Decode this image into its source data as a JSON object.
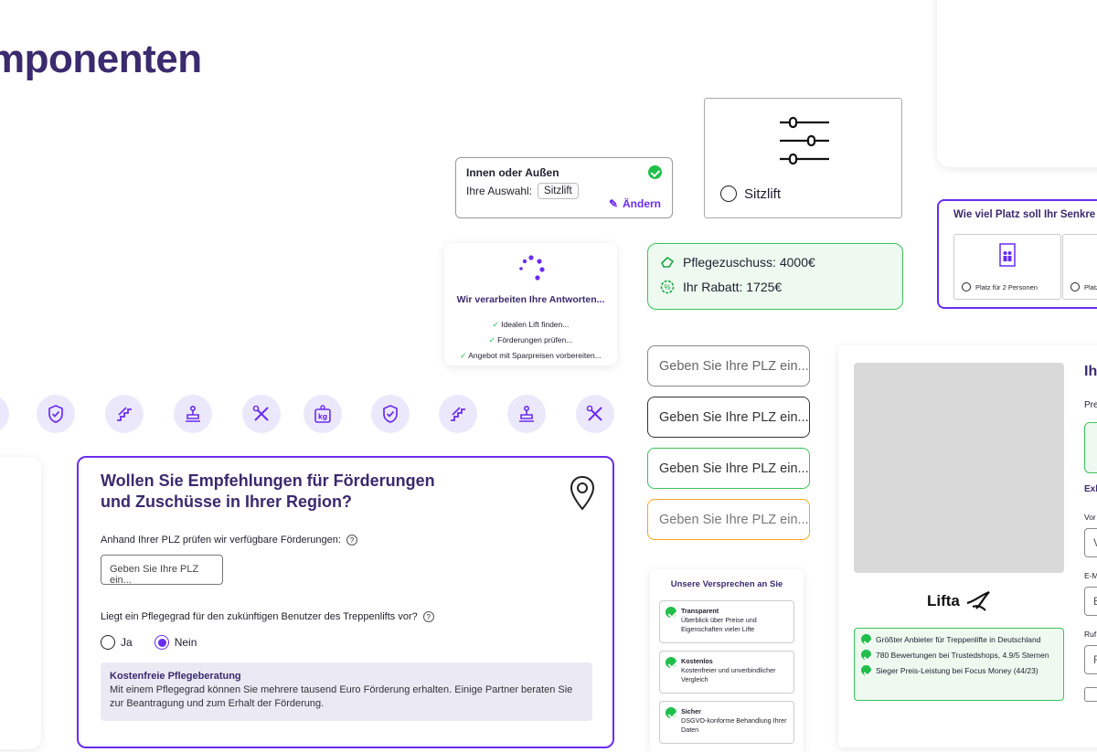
{
  "page_title": "mponenten",
  "selection": {
    "title": "Innen oder Außen",
    "label": "Ihre Auswahl:",
    "value": "Sitzlift",
    "change": "Ändern"
  },
  "option_card": {
    "label": "Sitzlift"
  },
  "processing": {
    "title": "Wir verarbeiten Ihre Antworten...",
    "steps": [
      "Idealen Lift finden...",
      "Förderungen prüfen...",
      "Angebot mit Sparpreisen vorbereiten..."
    ]
  },
  "subsidy": {
    "care": "Pflegezuschuss: 4000€",
    "discount": "Ihr Rabatt: 1725€"
  },
  "space": {
    "title": "Wie viel Platz soll Ihr Senkre",
    "opt1": "Platz für 2 Personen",
    "opt2": "Platz"
  },
  "plz_inputs": [
    "Geben Sie Ihre PLZ ein...",
    "Geben Sie Ihre PLZ ein...",
    "Geben Sie Ihre PLZ ein...",
    "Geben Sie Ihre PLZ ein..."
  ],
  "colors": {
    "accent": "#6a2cf0",
    "success": "#1fbf4a",
    "warning": "#f5a623",
    "dark": "#3a2a6e"
  },
  "icons": [
    "shield-check-icon",
    "stairs-icon",
    "stairlift-seat-icon",
    "tools-icon",
    "weight-kg-icon",
    "shield-check-icon",
    "stairs-icon",
    "stairlift-seat-icon",
    "tools-icon"
  ],
  "form": {
    "title_line1": "Wollen Sie Empfehlungen für Förderungen",
    "title_line2": "und Zuschüsse in Ihrer Region?",
    "plz_label": "Anhand Ihrer PLZ prüfen wir verfügbare Förderungen:",
    "plz_placeholder": "Geben Sie Ihre PLZ ein...",
    "question": "Liegt ein Pflegegrad für den zukünftigen Benutzer des Treppenlifts vor?",
    "yes": "Ja",
    "no": "Nein",
    "info_title": "Kostenfreie Pflegeberatung",
    "info_text": "Mit einem Pflegegrad können Sie mehrere tausend Euro Förderung erhalten. Einige Partner beraten Sie zur Beantragung und zum Erhalt der Förderung."
  },
  "promises": {
    "title": "Unsere Versprechen an Sie",
    "items": [
      {
        "title": "Transparent",
        "text": "Überblick über Preise und Eigenschaften vieler Lifte"
      },
      {
        "title": "Kostenlos",
        "text": "Kostenfreier und unverbindlicher Vergleich"
      },
      {
        "title": "Sicher",
        "text": "DSGVO-konforme Behandlung Ihrer Daten"
      }
    ]
  },
  "provider": {
    "logo": "Lifta",
    "facts": [
      "Größter Anbieter für Treppenlifte in Deutschland",
      "780 Bewertungen bei Trustedshops, 4.9/5 Sternen",
      "Sieger Preis-Leistung bei Focus Money (44/23)"
    ]
  },
  "right_form": {
    "heading": "Ih",
    "pre": "Pre",
    "ext": "Exk",
    "vor": "Vor",
    "v": "V",
    "email": "E-M",
    "e": "E",
    "ruf": "Ruf",
    "r": "R"
  }
}
